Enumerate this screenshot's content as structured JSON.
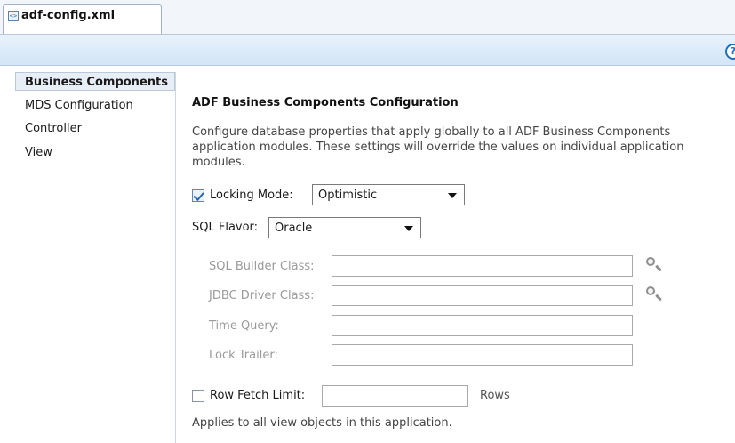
{
  "editor_tab": {
    "icon": "xml-file-icon",
    "icon_glyph": "<>",
    "label": "adf-config.xml"
  },
  "toolbar": {
    "help_icon": "help-icon",
    "help_glyph": "?"
  },
  "sidebar": {
    "items": [
      {
        "label": "Business Components",
        "selected": true
      },
      {
        "label": "MDS Configuration",
        "selected": false
      },
      {
        "label": "Controller",
        "selected": false
      },
      {
        "label": "View",
        "selected": false
      }
    ]
  },
  "main": {
    "heading": "ADF Business Components Configuration",
    "description": "Configure database properties that apply globally to all ADF Business Components application modules. These settings will override the values on individual application modules.",
    "locking_mode": {
      "checked": true,
      "label": "Locking Mode:",
      "value": "Optimistic"
    },
    "sql_flavor": {
      "label": "SQL Flavor:",
      "value": "Oracle"
    },
    "sql_builder_class": {
      "label": "SQL Builder Class:",
      "value": "",
      "browse_icon": "magnifier-icon"
    },
    "jdbc_driver_class": {
      "label": "JDBC Driver Class:",
      "value": "",
      "browse_icon": "magnifier-icon"
    },
    "time_query": {
      "label": "Time Query:",
      "value": ""
    },
    "lock_trailer": {
      "label": "Lock Trailer:",
      "value": ""
    },
    "row_fetch_limit": {
      "checked": false,
      "label": "Row Fetch Limit:",
      "value": "",
      "unit": "Rows"
    },
    "footer_note": "Applies to all view objects in this application."
  },
  "colors": {
    "toolbar_gradient_top": "#e9f2fb",
    "toolbar_gradient_bottom": "#d3e5f7",
    "accent": "#1f6fb8",
    "disabled_text": "#9a9a9a"
  }
}
